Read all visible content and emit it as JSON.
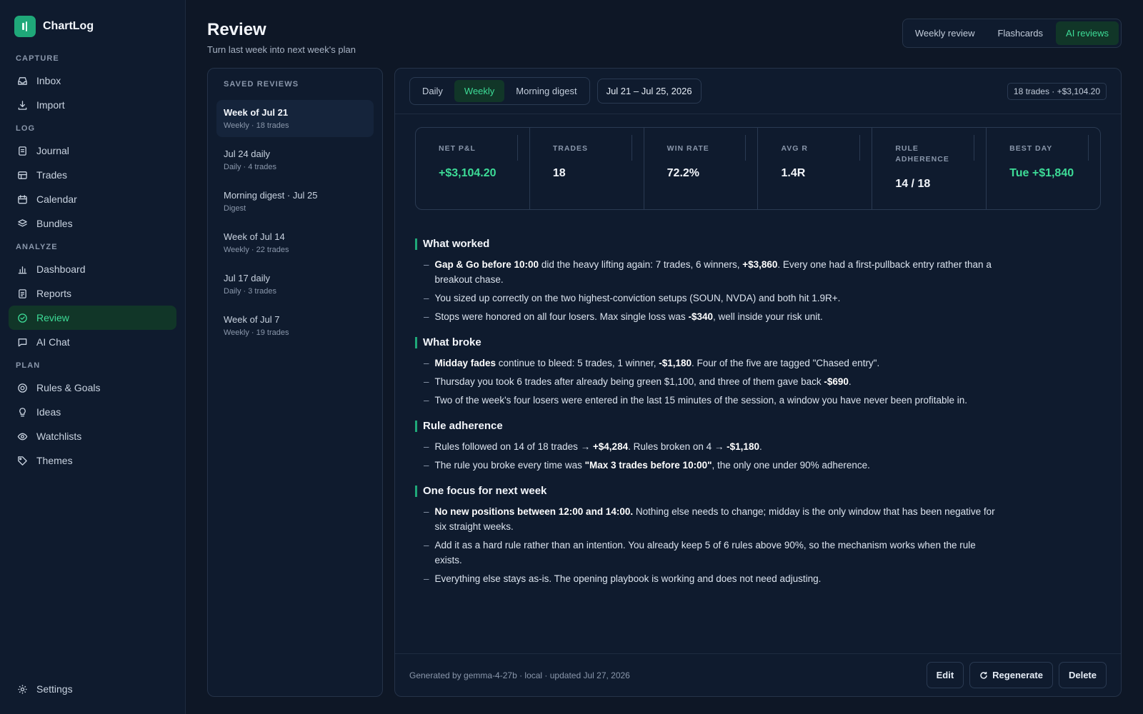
{
  "brand": {
    "name": "ChartLog"
  },
  "nav": {
    "groups": [
      {
        "label": "CAPTURE",
        "items": [
          {
            "label": "Inbox",
            "icon": "inbox-icon"
          },
          {
            "label": "Import",
            "icon": "download-icon"
          }
        ]
      },
      {
        "label": "LOG",
        "items": [
          {
            "label": "Journal",
            "icon": "journal-icon"
          },
          {
            "label": "Trades",
            "icon": "table-icon"
          },
          {
            "label": "Calendar",
            "icon": "calendar-icon"
          },
          {
            "label": "Bundles",
            "icon": "layers-icon"
          }
        ]
      },
      {
        "label": "ANALYZE",
        "items": [
          {
            "label": "Dashboard",
            "icon": "bar-chart-icon"
          },
          {
            "label": "Reports",
            "icon": "report-icon"
          },
          {
            "label": "Review",
            "icon": "check-circle-icon"
          },
          {
            "label": "AI Chat",
            "icon": "chat-icon"
          }
        ]
      },
      {
        "label": "PLAN",
        "items": [
          {
            "label": "Rules & Goals",
            "icon": "target-icon"
          },
          {
            "label": "Ideas",
            "icon": "bulb-icon"
          },
          {
            "label": "Watchlists",
            "icon": "eye-icon"
          },
          {
            "label": "Themes",
            "icon": "tag-icon"
          }
        ]
      }
    ],
    "active": "Review",
    "settings": "Settings"
  },
  "header": {
    "title": "Review",
    "subtitle": "Turn last week into next week's plan",
    "tabs": [
      "Weekly review",
      "Flashcards",
      "AI reviews"
    ],
    "active_tab": "AI reviews"
  },
  "saved": {
    "heading": "SAVED REVIEWS",
    "items": [
      {
        "title": "Week of Jul 21",
        "sub": "Weekly · 18 trades"
      },
      {
        "title": "Jul 24 daily",
        "sub": "Daily · 4 trades"
      },
      {
        "title": "Morning digest · Jul 25",
        "sub": "Digest"
      },
      {
        "title": "Week of Jul 14",
        "sub": "Weekly · 22 trades"
      },
      {
        "title": "Jul 17 daily",
        "sub": "Daily · 3 trades"
      },
      {
        "title": "Week of Jul 7",
        "sub": "Weekly · 19 trades"
      }
    ]
  },
  "panel": {
    "modes": [
      "Daily",
      "Weekly",
      "Morning digest"
    ],
    "active_mode": "Weekly",
    "date_range": "Jul 21 – Jul 25, 2026",
    "summary": "18 trades · +$3,104.20"
  },
  "stats": [
    {
      "label": "NET P&L",
      "value": "+$3,104.20",
      "green": true
    },
    {
      "label": "TRADES",
      "value": "18",
      "green": false
    },
    {
      "label": "WIN RATE",
      "value": "72.2%",
      "green": false
    },
    {
      "label": "AVG R",
      "value": "1.4R",
      "green": false
    },
    {
      "label": "RULE ADHERENCE",
      "value": "14 / 18",
      "green": false
    },
    {
      "label": "BEST DAY",
      "value": "Tue +$1,840",
      "green": true
    }
  ],
  "sections": [
    {
      "title": "What worked",
      "bullets": [
        [
          {
            "b": "Gap & Go before 10:00"
          },
          {
            "t": " did the heavy lifting again: 7 trades, 6 winners, "
          },
          {
            "b": "+$3,860"
          },
          {
            "t": ". Every one had a first-pullback entry rather than a breakout chase."
          }
        ],
        [
          {
            "t": "You sized up correctly on the two highest-conviction setups (SOUN, NVDA) and both hit 1.9R+."
          }
        ],
        [
          {
            "t": "Stops were honored on all four losers. Max single loss was "
          },
          {
            "b": "-$340"
          },
          {
            "t": ", well inside your risk unit."
          }
        ]
      ]
    },
    {
      "title": "What broke",
      "bullets": [
        [
          {
            "b": "Midday fades"
          },
          {
            "t": " continue to bleed: 5 trades, 1 winner, "
          },
          {
            "b": "-$1,180"
          },
          {
            "t": ". Four of the five are tagged \"Chased entry\"."
          }
        ],
        [
          {
            "t": "Thursday you took 6 trades after already being green $1,100, and three of them gave back "
          },
          {
            "b": "-$690"
          },
          {
            "t": "."
          }
        ],
        [
          {
            "t": "Two of the week's four losers were entered in the last 15 minutes of the session, a window you have never been profitable in."
          }
        ]
      ]
    },
    {
      "title": "Rule adherence",
      "bullets": [
        [
          {
            "t": "Rules followed on 14 of 18 trades → "
          },
          {
            "b": "+$4,284"
          },
          {
            "t": ". Rules broken on 4 → "
          },
          {
            "b": "-$1,180"
          },
          {
            "t": "."
          }
        ],
        [
          {
            "t": "The rule you broke every time was "
          },
          {
            "b": "\"Max 3 trades before 10:00\""
          },
          {
            "t": ", the only one under 90% adherence."
          }
        ]
      ]
    },
    {
      "title": "One focus for next week",
      "bullets": [
        [
          {
            "b": "No new positions between 12:00 and 14:00."
          },
          {
            "t": " Nothing else needs to change; midday is the only window that has been negative for six straight weeks."
          }
        ],
        [
          {
            "t": "Add it as a hard rule rather than an intention. You already keep 5 of 6 rules above 90%, so the mechanism works when the rule exists."
          }
        ],
        [
          {
            "t": "Everything else stays as-is. The opening playbook is working and does not need adjusting."
          }
        ]
      ]
    }
  ],
  "footer": {
    "generated": "Generated by gemma-4-27b · local · updated Jul 27, 2026",
    "edit": "Edit",
    "regenerate": "Regenerate",
    "delete": "Delete"
  },
  "colors": {
    "accent": "#3ddc97",
    "accent_bg": "#113628",
    "bg": "#0e1726",
    "panel": "#0f1b2e"
  }
}
